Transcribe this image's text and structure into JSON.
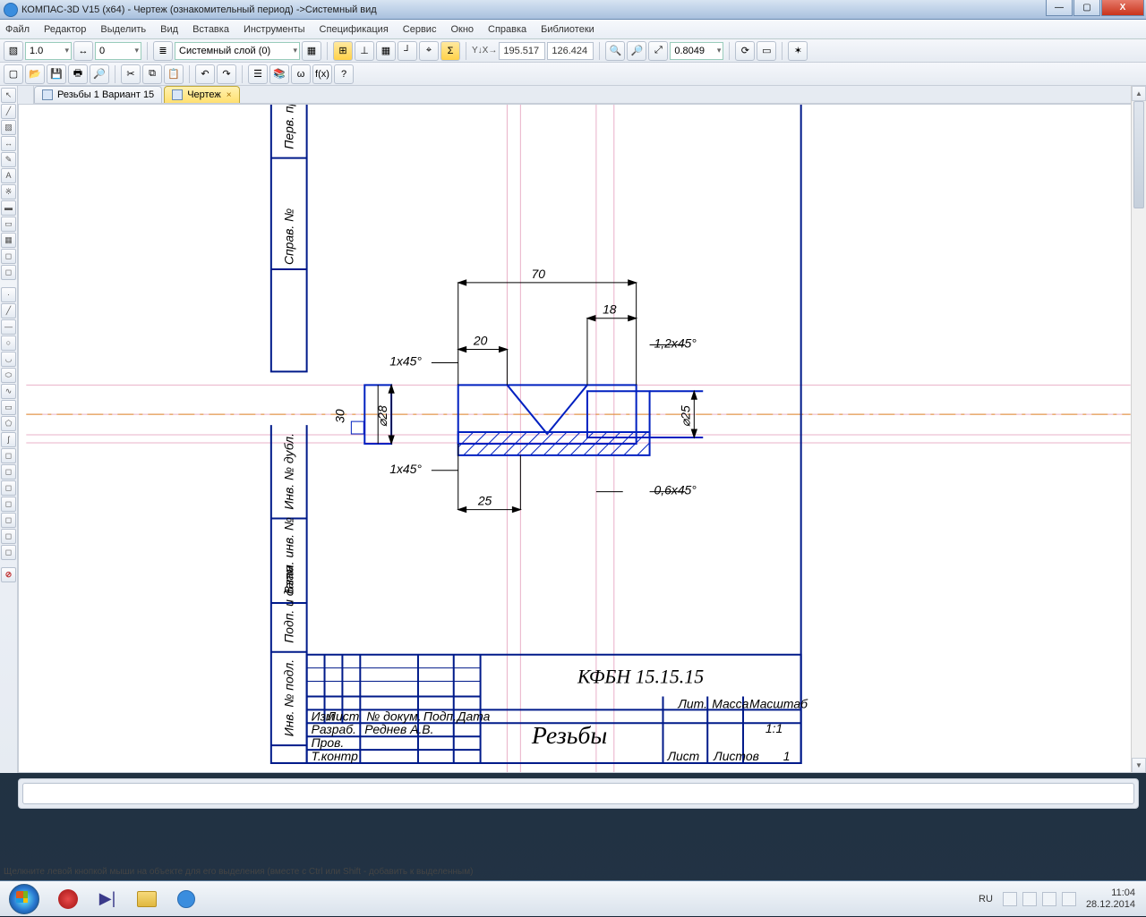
{
  "window": {
    "title": "КОМПАС-3D V15 (x64) - Чертеж (ознакомительный период) ->Системный вид",
    "min": "—",
    "max": "▢",
    "close": "X"
  },
  "menu": [
    "Файл",
    "Редактор",
    "Выделить",
    "Вид",
    "Вставка",
    "Инструменты",
    "Спецификация",
    "Сервис",
    "Окно",
    "Справка",
    "Библиотеки"
  ],
  "toprow": {
    "scale_combo": "1.0",
    "step_combo": "0",
    "layer_combo": "Системный слой (0)",
    "coord_x": "195.517",
    "coord_y": "126.424",
    "zoom": "0.8049"
  },
  "tabs": [
    {
      "label": "Резьбы 1 Вариант 15",
      "active": false
    },
    {
      "label": "Чертеж",
      "active": true
    }
  ],
  "drawing": {
    "d70": "70",
    "d18": "18",
    "d20": "20",
    "d25": "25",
    "ch1": "1x45°",
    "ch12": "1,2x45°",
    "ch06": "0,6x45°",
    "ch1b": "1x45°",
    "dia28": "⌀28",
    "dia25": "⌀25",
    "h30": "30",
    "titleblock": {
      "code": "КФБН 15.15.15",
      "name": "Резьбы",
      "row_izm": "Изм",
      "row_list": "Лист",
      "row_ndoc": "№ докум.",
      "row_podp": "Подп.",
      "row_data": "Дата",
      "razrab": "Разраб.",
      "razrab_v": "Реднев А.В.",
      "prov": "Пров.",
      "tkontr": "Т.контр",
      "lit": "Лит.",
      "massa": "Масса",
      "masht": "Масштаб",
      "masht_v": "1:1",
      "list": "Лист",
      "listov": "Листов",
      "listov_v": "1"
    },
    "stampcols": [
      "Перв. примен.",
      "Справ. №",
      "Подп. и дата",
      "Инв. № дубл.",
      "Взам. инв. №",
      "Подп. и дата",
      "Инв. № подл."
    ]
  },
  "status": "Щелкните левой кнопкой мыши на объекте для его выделения (вместе с Ctrl или Shift - добавить к выделенным)",
  "tray": {
    "lang": "RU",
    "time": "11:04",
    "date": "28.12.2014"
  }
}
